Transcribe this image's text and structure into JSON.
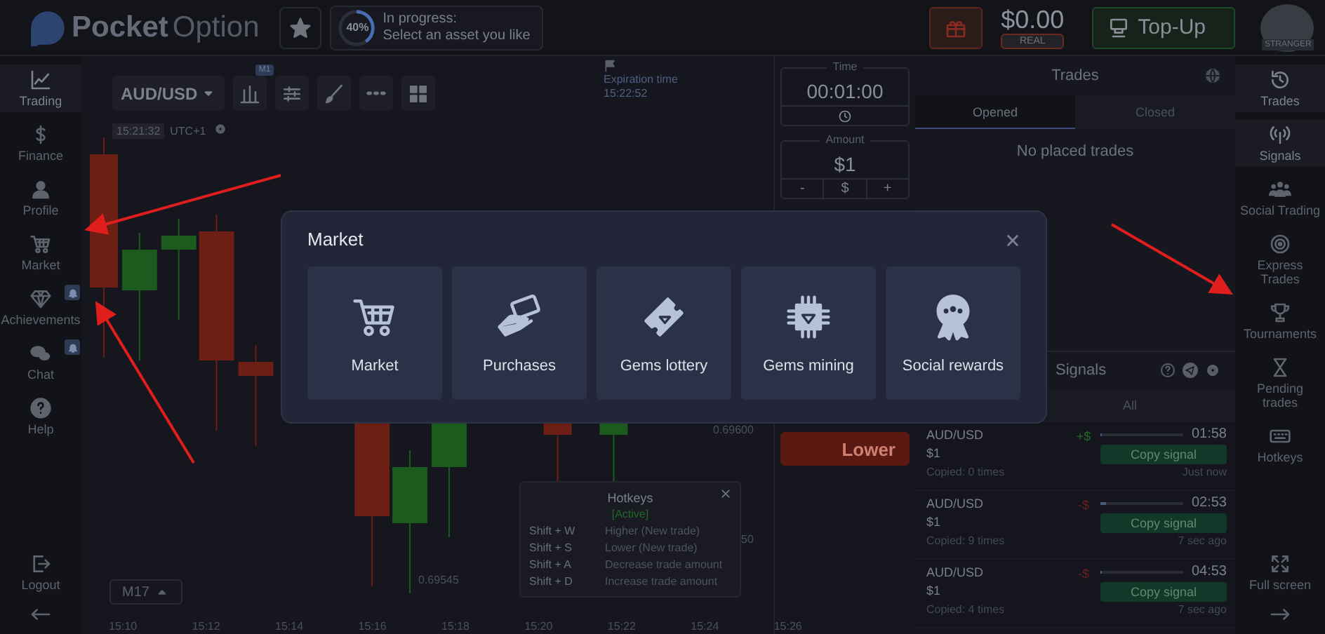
{
  "header": {
    "logo": {
      "bold": "Pocket",
      "light": "Option"
    },
    "progress": {
      "percent": "40%",
      "level": 0.4,
      "title": "In progress:",
      "subtitle": "Select an asset you like"
    },
    "balance": "$0.00",
    "account_type": "REAL",
    "topup": "Top-Up",
    "avatar_badge": "STRANGER"
  },
  "left_nav": {
    "items": [
      {
        "label": "Trading",
        "selected": true,
        "badge": false
      },
      {
        "label": "Finance",
        "selected": false,
        "badge": false
      },
      {
        "label": "Profile",
        "selected": false,
        "badge": false
      },
      {
        "label": "Market",
        "selected": false,
        "badge": false
      },
      {
        "label": "Achievements",
        "selected": false,
        "badge": true
      },
      {
        "label": "Chat",
        "selected": false,
        "badge": true
      },
      {
        "label": "Help",
        "selected": false,
        "badge": false
      }
    ],
    "footer": {
      "label": "Logout"
    }
  },
  "chart": {
    "asset": "AUD/USD",
    "timeframe_badge": "M1",
    "clock": "15:21:32",
    "timezone": "UTC+1",
    "expiration": {
      "label": "Expiration time",
      "value": "15:22:52"
    },
    "price_labels": [
      "0.69600",
      "50",
      "0.69545"
    ],
    "timeframe": "M17",
    "times": [
      "15:10",
      "15:12",
      "15:14",
      "15:16",
      "15:18",
      "15:20",
      "15:22",
      "15:24",
      "15:26"
    ]
  },
  "hotkeys": {
    "title": "Hotkeys",
    "status": "[Active]",
    "rows": [
      {
        "keys": "Shift + W",
        "action": "Higher (New trade)"
      },
      {
        "keys": "Shift + S",
        "action": "Lower (New trade)"
      },
      {
        "keys": "Shift + A",
        "action": "Decrease trade amount"
      },
      {
        "keys": "Shift + D",
        "action": "Increase trade amount"
      }
    ]
  },
  "trade_controls": {
    "time": {
      "label": "Time",
      "value": "00:01:00"
    },
    "amount": {
      "label": "Amount",
      "value": "$1",
      "minus": "-",
      "currency": "$",
      "plus": "+"
    },
    "lower": "Lower"
  },
  "trades": {
    "title": "Trades",
    "tabs": [
      {
        "label": "Opened",
        "selected": true
      },
      {
        "label": "Closed",
        "selected": false
      }
    ],
    "empty": "No placed trades"
  },
  "signals": {
    "title": "Signals",
    "tab": "All",
    "items": [
      {
        "pair": "AUD/USD",
        "amount": "$1",
        "copied": "Copied: 0 times",
        "change": "+$",
        "positive": true,
        "timer": "01:58",
        "level": 0.02,
        "button": "Copy signal",
        "ago": "Just now"
      },
      {
        "pair": "AUD/USD",
        "amount": "$1",
        "copied": "Copied: 9 times",
        "change": "-$",
        "positive": false,
        "timer": "02:53",
        "level": 0.06,
        "button": "Copy signal",
        "ago": "7 sec ago"
      },
      {
        "pair": "AUD/USD",
        "amount": "$1",
        "copied": "Copied: 4 times",
        "change": "-$",
        "positive": false,
        "timer": "04:53",
        "level": 0.02,
        "button": "Copy signal",
        "ago": "7 sec ago"
      }
    ]
  },
  "right_nav": {
    "items": [
      {
        "label": "Trades",
        "selected": true
      },
      {
        "label": "Signals",
        "selected": true
      },
      {
        "label": "Social Trading",
        "selected": false
      },
      {
        "label": "Express Trades",
        "selected": false
      },
      {
        "label": "Tournaments",
        "selected": false
      },
      {
        "label": "Pending trades",
        "selected": false
      },
      {
        "label": "Hotkeys",
        "selected": false
      }
    ],
    "footer": {
      "label": "Full screen"
    }
  },
  "modal": {
    "title": "Market",
    "tiles": [
      {
        "label": "Market"
      },
      {
        "label": "Purchases"
      },
      {
        "label": "Gems lottery"
      },
      {
        "label": "Gems mining"
      },
      {
        "label": "Social rewards"
      }
    ]
  }
}
